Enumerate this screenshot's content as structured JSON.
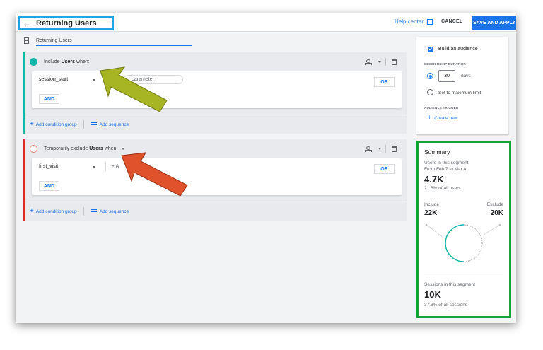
{
  "header": {
    "back_icon": "arrow-left-icon",
    "title": "Returning Users",
    "help_label": "Help center",
    "cancel_label": "CANCEL",
    "save_label": "SAVE AND APPLY"
  },
  "segment": {
    "name": "Returning Users"
  },
  "include_group": {
    "prefix": "Include",
    "keyword": "Users",
    "suffix": "when:",
    "condition": "session_start",
    "param_placeholder": "parameter",
    "or_label": "OR",
    "and_label": "AND",
    "add_group_label": "Add condition group",
    "add_sequence_label": "Add sequence",
    "accent": "#12b5a8"
  },
  "exclude_group": {
    "prefix": "Temporarily exclude",
    "keyword": "Users",
    "suffix": "when:",
    "condition": "first_visit",
    "param_placeholder": "+ A",
    "or_label": "OR",
    "and_label": "AND",
    "add_group_label": "Add condition group",
    "add_sequence_label": "Add sequence",
    "accent": "#d93025"
  },
  "audience": {
    "build_label": "Build an audience",
    "build_checked": true,
    "membership_label": "MEMBERSHIP DURATION",
    "duration_value": "30",
    "duration_unit": "days",
    "max_limit_label": "Set to maximum limit",
    "trigger_label": "AUDIENCE TRIGGER",
    "create_label": "Create new"
  },
  "summary": {
    "title": "Summary",
    "users_label": "Users in this segment",
    "date_range": "From Feb 7 to Mar 8",
    "users_value": "4.7K",
    "users_pct": "21.6% of all users",
    "include_label": "Include",
    "include_value": "22K",
    "exclude_label": "Exclude",
    "exclude_value": "20K",
    "sessions_label": "Sessions in this segment",
    "sessions_value": "10K",
    "sessions_pct": "37.3% of all sessions"
  },
  "colors": {
    "primary": "#1a73e8",
    "highlight_blue": "#1fa5e8",
    "highlight_green": "#16a337",
    "arrow_olive": "#a7b524",
    "arrow_red": "#e0522c"
  }
}
